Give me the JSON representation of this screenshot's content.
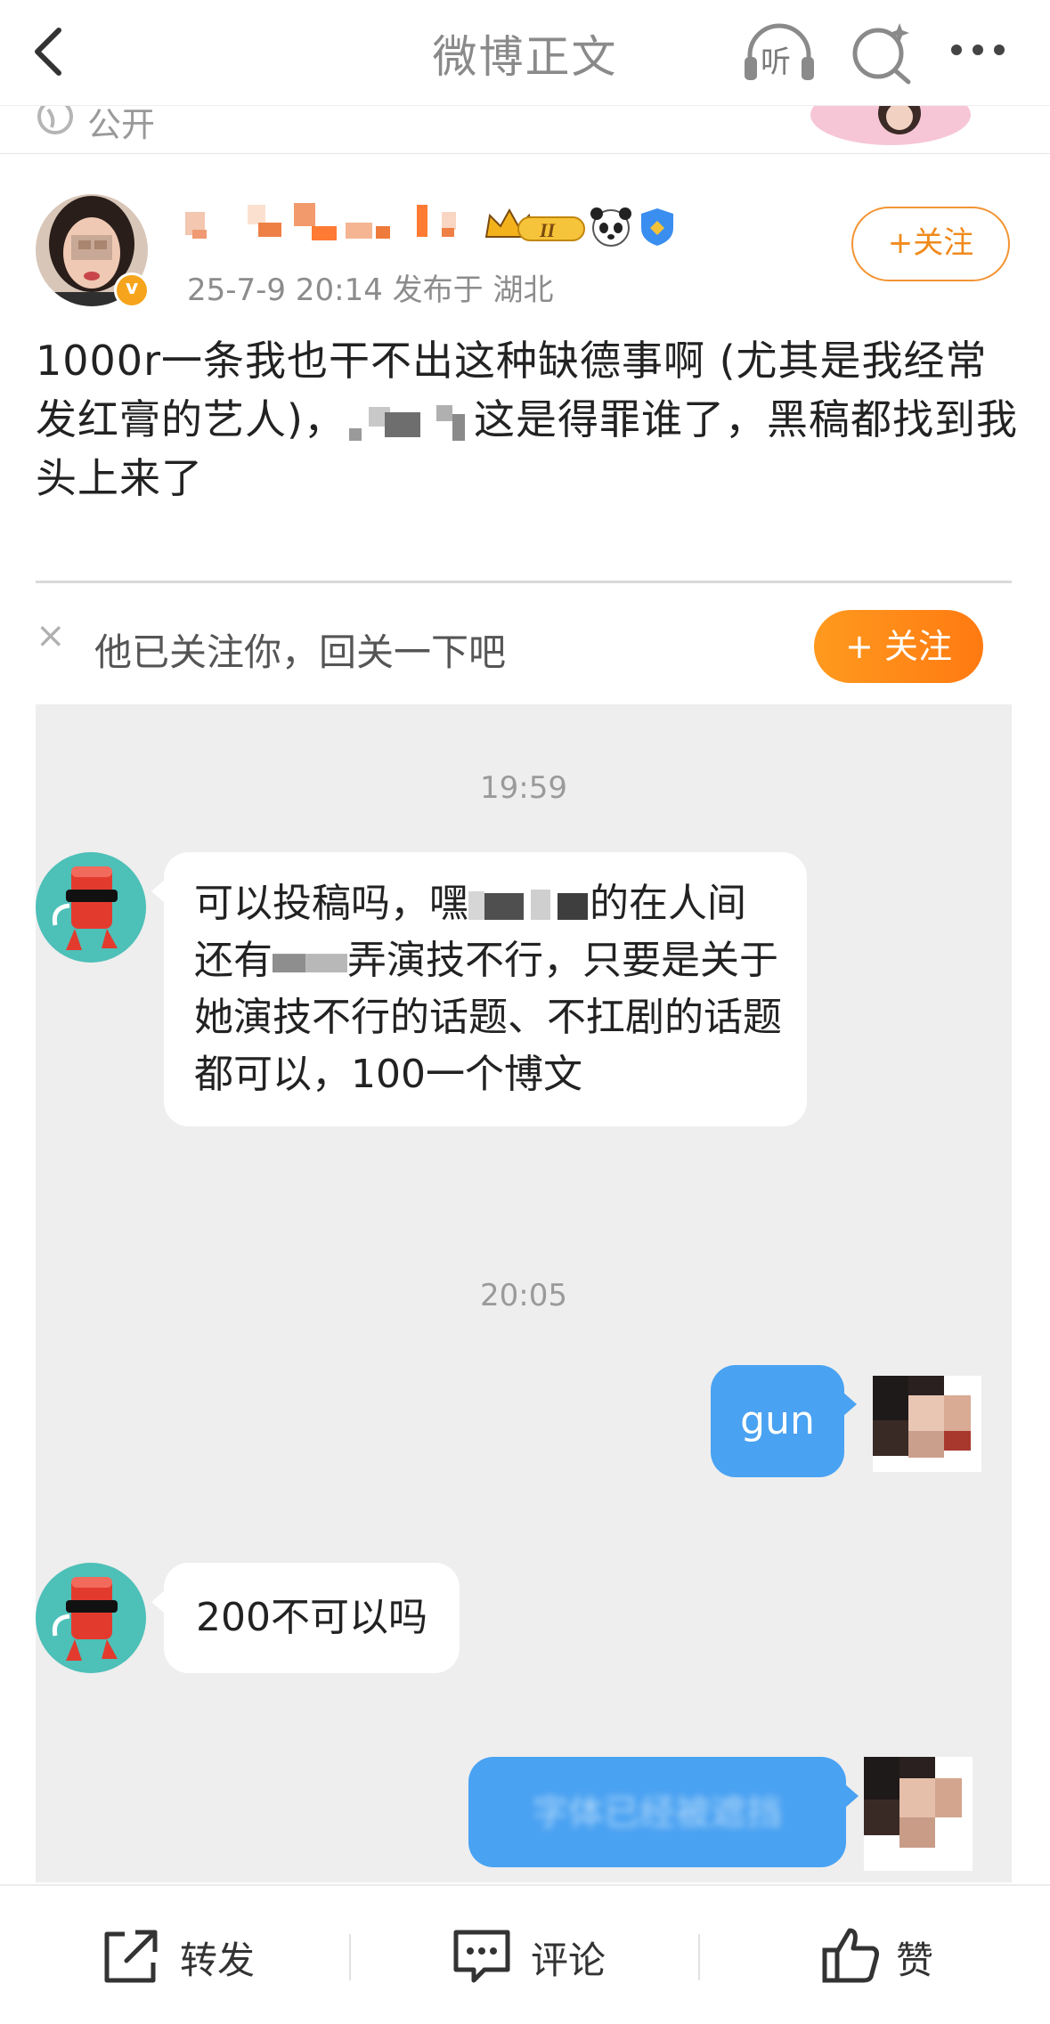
{
  "header": {
    "title": "微博正文",
    "listen_label": "听",
    "privacy_label": "公开"
  },
  "post": {
    "author_verified_mark": "v",
    "meta": "25-7-9 20:14  发布于 湖北",
    "follow_label": "+关注",
    "text_part1": "1000r一条我也干不出这种缺德事啊 (尤其是我经常发红膏的艺人)，",
    "text_part2": "这是得罪谁了，黑稿都找到我头上来了"
  },
  "embed": {
    "follow_bar_text": "他已关注你，回关一下吧",
    "follow_bar_close": "×",
    "follow_bar_button": "+ 关注",
    "messages": [
      {
        "time": "19:59"
      },
      {
        "text_part1": "可以投稿吗，嘿",
        "text_part2": "的在人间还有",
        "text_part3": "弄演技不行，只要是关于她演技不行的话题、不扛剧的话题都可以，100一个博文"
      },
      {
        "time": "20:05"
      },
      {
        "text": "gun"
      },
      {
        "text": "200不可以吗"
      },
      {
        "text": "字体已经被遮挡"
      }
    ]
  },
  "toolbar": {
    "repost": "转发",
    "comment": "评论",
    "like": "赞"
  },
  "colors": {
    "accent_orange": "#f08a1c",
    "bubble_blue": "#4aa2f2",
    "chat_bg": "#eeeeee",
    "bot_avatar_teal": "#4dc0b8"
  }
}
